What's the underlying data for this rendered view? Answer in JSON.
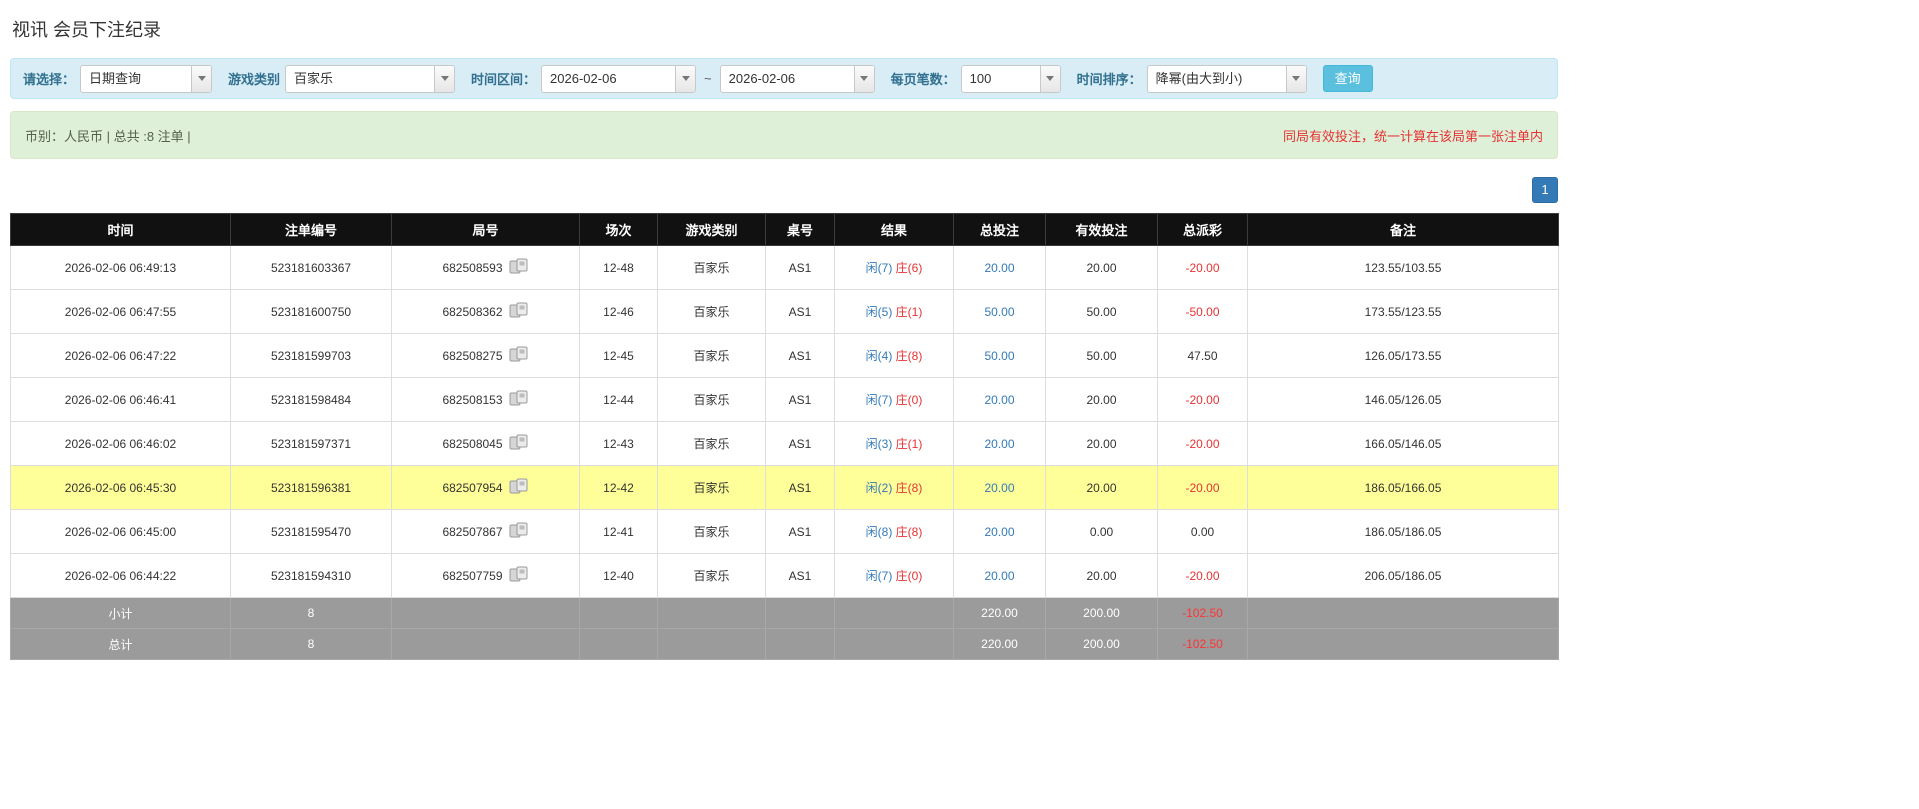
{
  "page": {
    "title": "视讯 会员下注纪录"
  },
  "filters": {
    "select_label": "请选择：",
    "select_value": "日期查询",
    "game_type_label": "游戏类别",
    "game_type_value": "百家乐",
    "time_range_label": "时间区间：",
    "date_from": "2026-02-06",
    "tilde": "~",
    "date_to": "2026-02-06",
    "page_size_label": "每页笔数：",
    "page_size_value": "100",
    "sort_label": "时间排序：",
    "sort_value": "降幂(由大到小)",
    "search_button": "查询"
  },
  "summary": {
    "left": "币别：人民币 | 总共 :8 注单 |",
    "right": "同局有效投注，统一计算在该局第一张注单内"
  },
  "pagination": {
    "current_page": "1"
  },
  "table": {
    "headers": [
      "时间",
      "注单编号",
      "局号",
      "场次",
      "游戏类别",
      "桌号",
      "结果",
      "总投注",
      "有效投注",
      "总派彩",
      "备注"
    ],
    "rows": [
      {
        "time": "2026-02-06 06:49:13",
        "bet_id": "523181603367",
        "round": "682508593",
        "session": "12-48",
        "game": "百家乐",
        "table_no": "AS1",
        "result_player": "闲(7)",
        "result_banker": "庄(6)",
        "total_bet": "20.00",
        "valid_bet": "20.00",
        "payout": "-20.00",
        "payout_negative": true,
        "note": "123.55/103.55",
        "highlight": false
      },
      {
        "time": "2026-02-06 06:47:55",
        "bet_id": "523181600750",
        "round": "682508362",
        "session": "12-46",
        "game": "百家乐",
        "table_no": "AS1",
        "result_player": "闲(5)",
        "result_banker": "庄(1)",
        "total_bet": "50.00",
        "valid_bet": "50.00",
        "payout": "-50.00",
        "payout_negative": true,
        "note": "173.55/123.55",
        "highlight": false
      },
      {
        "time": "2026-02-06 06:47:22",
        "bet_id": "523181599703",
        "round": "682508275",
        "session": "12-45",
        "game": "百家乐",
        "table_no": "AS1",
        "result_player": "闲(4)",
        "result_banker": "庄(8)",
        "total_bet": "50.00",
        "valid_bet": "50.00",
        "payout": "47.50",
        "payout_negative": false,
        "note": "126.05/173.55",
        "highlight": false
      },
      {
        "time": "2026-02-06 06:46:41",
        "bet_id": "523181598484",
        "round": "682508153",
        "session": "12-44",
        "game": "百家乐",
        "table_no": "AS1",
        "result_player": "闲(7)",
        "result_banker": "庄(0)",
        "total_bet": "20.00",
        "valid_bet": "20.00",
        "payout": "-20.00",
        "payout_negative": true,
        "note": "146.05/126.05",
        "highlight": false
      },
      {
        "time": "2026-02-06 06:46:02",
        "bet_id": "523181597371",
        "round": "682508045",
        "session": "12-43",
        "game": "百家乐",
        "table_no": "AS1",
        "result_player": "闲(3)",
        "result_banker": "庄(1)",
        "total_bet": "20.00",
        "valid_bet": "20.00",
        "payout": "-20.00",
        "payout_negative": true,
        "note": "166.05/146.05",
        "highlight": false
      },
      {
        "time": "2026-02-06 06:45:30",
        "bet_id": "523181596381",
        "round": "682507954",
        "session": "12-42",
        "game": "百家乐",
        "table_no": "AS1",
        "result_player": "闲(2)",
        "result_banker": "庄(8)",
        "total_bet": "20.00",
        "valid_bet": "20.00",
        "payout": "-20.00",
        "payout_negative": true,
        "note": "186.05/166.05",
        "highlight": true
      },
      {
        "time": "2026-02-06 06:45:00",
        "bet_id": "523181595470",
        "round": "682507867",
        "session": "12-41",
        "game": "百家乐",
        "table_no": "AS1",
        "result_player": "闲(8)",
        "result_banker": "庄(8)",
        "total_bet": "20.00",
        "valid_bet": "0.00",
        "payout": "0.00",
        "payout_negative": false,
        "note": "186.05/186.05",
        "highlight": false
      },
      {
        "time": "2026-02-06 06:44:22",
        "bet_id": "523181594310",
        "round": "682507759",
        "session": "12-40",
        "game": "百家乐",
        "table_no": "AS1",
        "result_player": "闲(7)",
        "result_banker": "庄(0)",
        "total_bet": "20.00",
        "valid_bet": "20.00",
        "payout": "-20.00",
        "payout_negative": true,
        "note": "206.05/186.05",
        "highlight": false
      }
    ],
    "footer": [
      {
        "label": "小计",
        "count": "8",
        "total_bet": "220.00",
        "valid_bet": "200.00",
        "payout": "-102.50"
      },
      {
        "label": "总计",
        "count": "8",
        "total_bet": "220.00",
        "valid_bet": "200.00",
        "payout": "-102.50"
      }
    ]
  }
}
